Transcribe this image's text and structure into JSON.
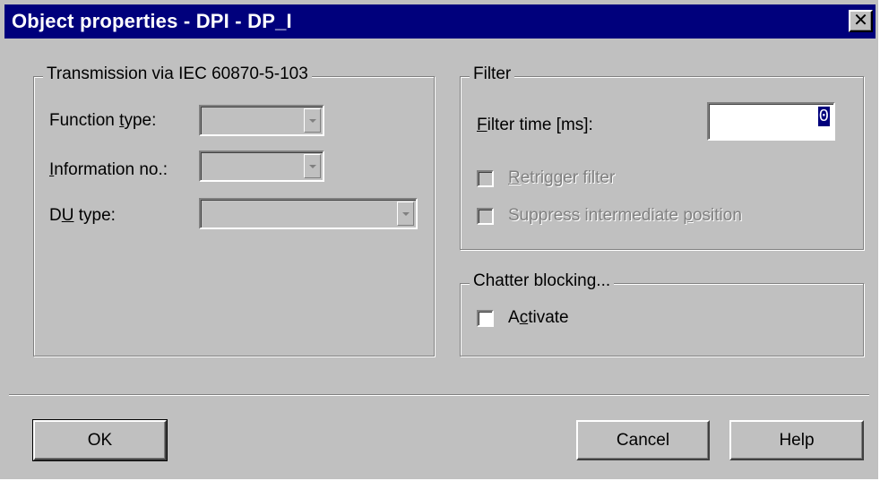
{
  "window": {
    "title": "Object properties - DPI - DP_I",
    "close_glyph": "✕"
  },
  "transmission_group": {
    "title": "Transmission via IEC 60870-5-103",
    "function_type": {
      "label_pre": "Function ",
      "label_hot": "t",
      "label_post": "ype:",
      "value": ""
    },
    "information_no": {
      "label_pre": "",
      "label_hot": "I",
      "label_post": "nformation no.:",
      "value": ""
    },
    "du_type": {
      "label_pre": "D",
      "label_hot": "U",
      "label_post": " type:",
      "value": ""
    }
  },
  "filter_group": {
    "title": "Filter",
    "filter_time": {
      "label_pre": "",
      "label_hot": "F",
      "label_post": "ilter time [ms]:",
      "value": "0"
    },
    "retrigger": {
      "label_pre": "",
      "label_hot": "R",
      "label_post": "etrigger filter",
      "checked": false,
      "enabled": false
    },
    "suppress": {
      "label_pre": "Suppress intermediate ",
      "label_hot": "p",
      "label_post": "osition",
      "checked": false,
      "enabled": false
    }
  },
  "chatter_group": {
    "title": "Chatter blocking...",
    "activate": {
      "label_pre": "A",
      "label_hot": "c",
      "label_post": "tivate",
      "checked": false,
      "enabled": true
    }
  },
  "buttons": {
    "ok": "OK",
    "cancel": "Cancel",
    "help": "Help"
  }
}
